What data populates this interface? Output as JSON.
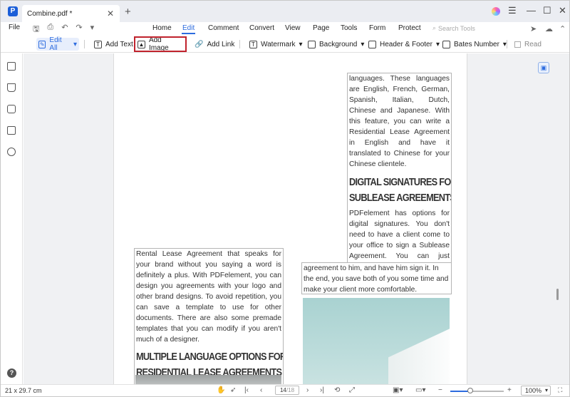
{
  "tab": {
    "title": "Combine.pdf *"
  },
  "menu": {
    "file": "File",
    "items": [
      "Home",
      "Edit",
      "Comment",
      "Convert",
      "View",
      "Page",
      "Tools",
      "Form",
      "Protect"
    ],
    "active": "Edit",
    "search_placeholder": "Search Tools"
  },
  "toolbar": {
    "edit_all": "Edit All",
    "add_text": "Add Text",
    "add_image": "Add Image",
    "add_link": "Add Link",
    "watermark": "Watermark",
    "background": "Background",
    "header_footer": "Header & Footer",
    "bates_number": "Bates Number",
    "read": "Read"
  },
  "document": {
    "right_col_text": "languages. These languages are English, French, German, Spanish, Italian, Dutch, Chinese and Japanese. With this feature, you can write a Residential Lease Agreement in English and have it translated to Chinese for your Chinese clientele.",
    "heading_signatures_1": "DIGITAL SIGNATURES FOR",
    "heading_signatures_2": "SUBLEASE AGREEMENTS",
    "signatures_text": "PDFelement has options for digital signatures. You don't need to have a client come to your office to sign a Sublease Agreement. You can just enable digital signatures, send the",
    "signatures_cont": "agreement to him, and have him sign it. In the end, you save both of you some time and make your client more comfortable.",
    "left_col_text": "Rental Lease Agreement that speaks for your brand without you saying a word is definitely a plus. With PDFelement, you can design you agreements with your logo and other brand designs. To avoid repetition, you can save a template to use for other documents. There are also some premade templates that you can modify if you aren't much of a designer.",
    "heading_languages_1": "MULTIPLE LANGUAGE OPTIONS FOR",
    "heading_languages_2": "RESIDENTIAL LEASE AGREEMENTS"
  },
  "status": {
    "page_size": "21 x 29.7 cm",
    "page_current": "14",
    "page_total": "/18",
    "zoom": "100%",
    "zoom_level_percent": 36
  }
}
